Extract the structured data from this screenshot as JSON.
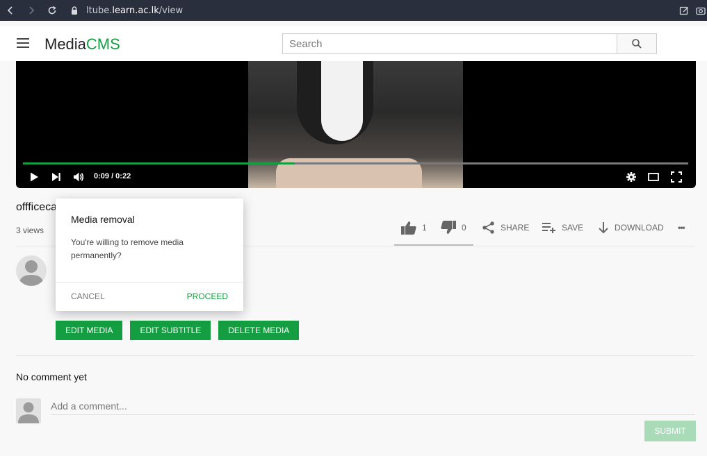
{
  "browser": {
    "url_prefix": "ltube.",
    "url_domain": "learn.ac.lk",
    "url_path": "/view"
  },
  "header": {
    "logo_media": "Media",
    "logo_cms": "CMS",
    "search_placeholder": "Search"
  },
  "player": {
    "time": "0:09 / 0:22",
    "progress_fraction": 0.409
  },
  "media": {
    "title": "offficeca",
    "views": "3 views",
    "likes": "1",
    "dislikes": "0",
    "share_label": "SHARE",
    "save_label": "SAVE",
    "download_label": "DOWNLOAD",
    "more_label": "•••"
  },
  "edit": {
    "edit_media": "EDIT MEDIA",
    "edit_subtitle": "EDIT SUBTITLE",
    "delete_media": "DELETE MEDIA"
  },
  "comments": {
    "empty_text": "No comment yet",
    "placeholder": "Add a comment...",
    "submit": "SUBMIT"
  },
  "dialog": {
    "title": "Media removal",
    "message": "You're willing to remove media permanently?",
    "cancel": "CANCEL",
    "proceed": "PROCEED"
  },
  "colors": {
    "brand_green": "#159e41",
    "browser_bar": "#2a2f3e"
  }
}
